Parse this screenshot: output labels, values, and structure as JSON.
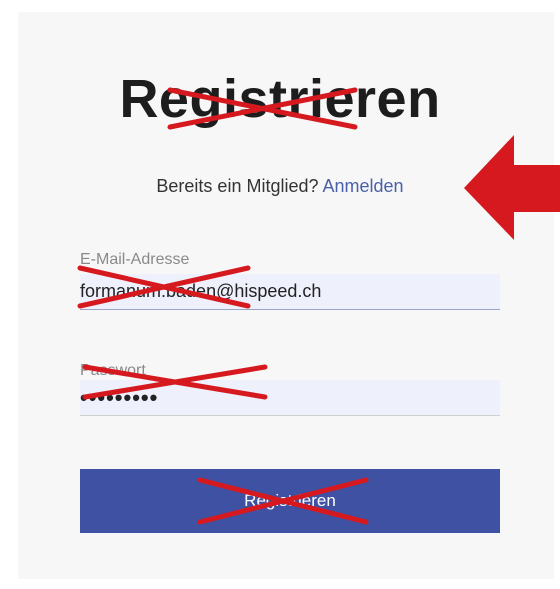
{
  "title": "Registrieren",
  "subtitle": {
    "text": "Bereits ein Mitglied?",
    "login_link": "Anmelden"
  },
  "email": {
    "label": "E-Mail-Adresse",
    "value": "formanum.baden@hispeed.ch"
  },
  "password": {
    "label": "Passwort",
    "value": "•••••••••"
  },
  "submit_label": "Registrieren",
  "colors": {
    "accent": "#3f51a3",
    "link": "#4a61a8",
    "annotation_red": "#d6191f",
    "field_background": "#eef0fb"
  }
}
